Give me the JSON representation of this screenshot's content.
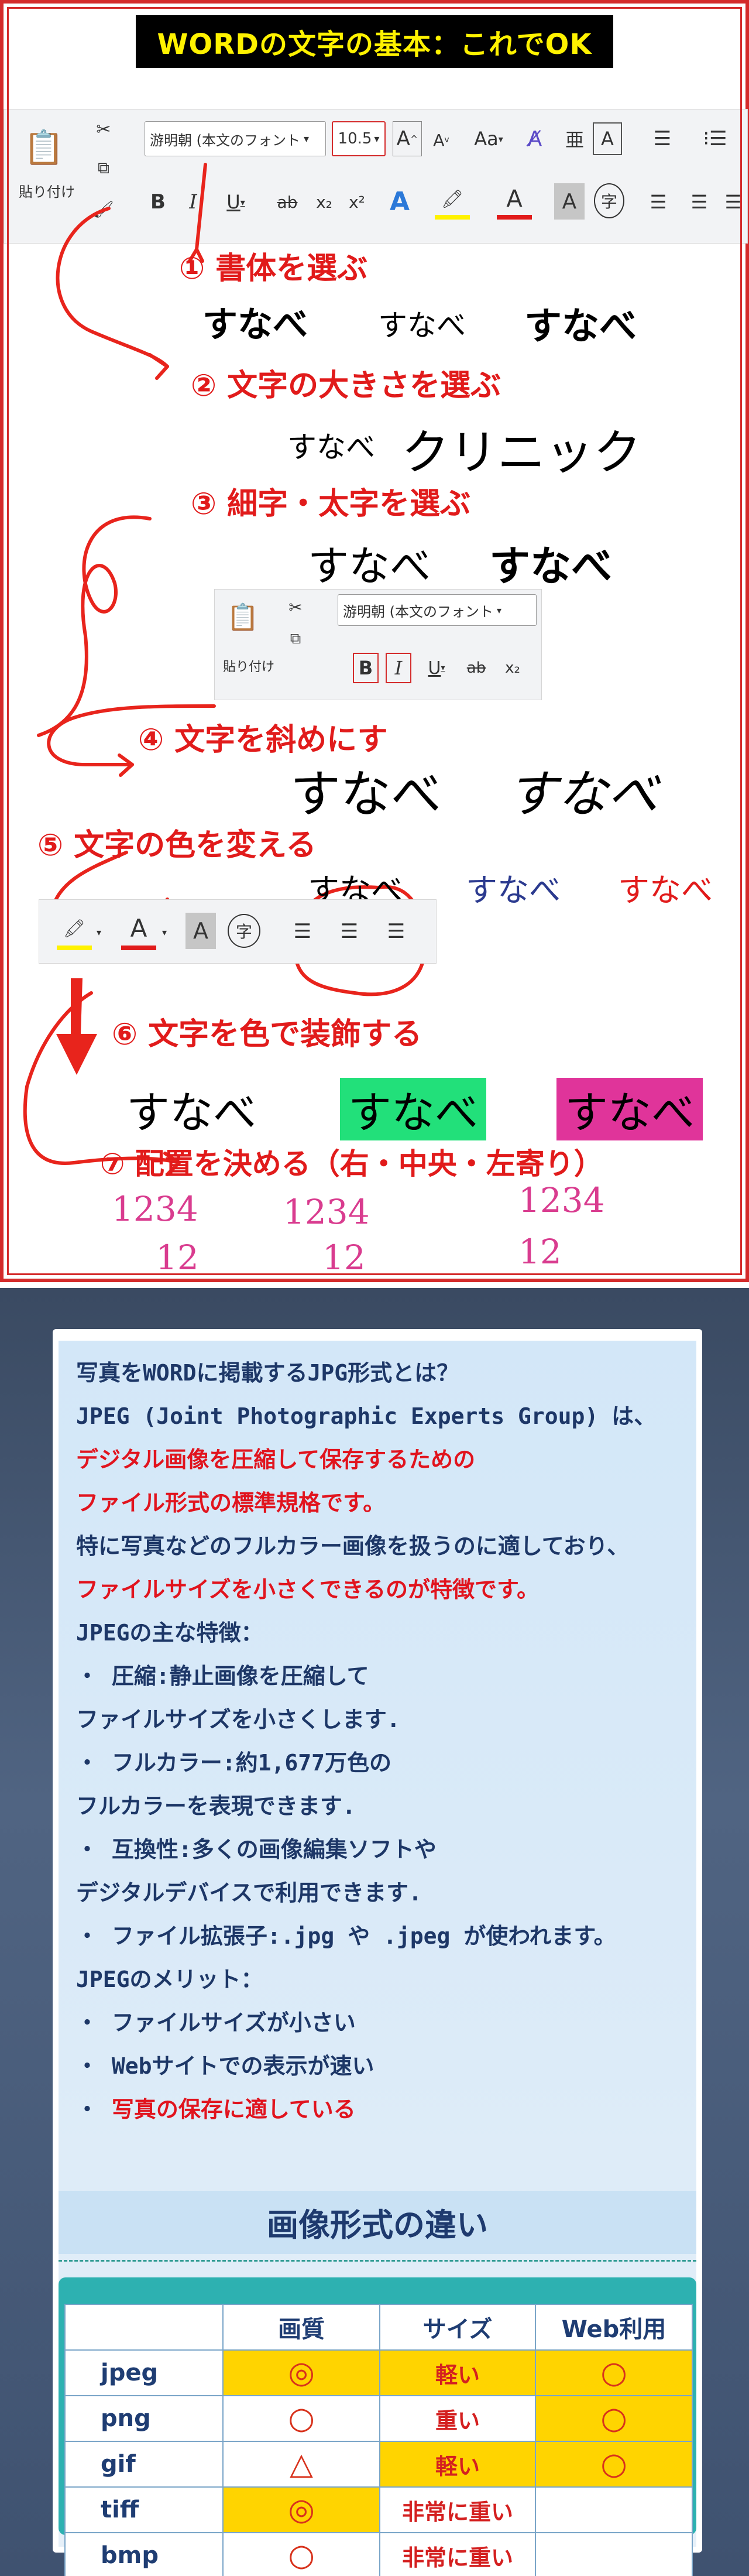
{
  "banner": "WORDの文字の基本：これでOK",
  "ribbon1": {
    "paste": "貼り付け",
    "font_name": "游明朝 (本文のフォント",
    "font_size": "10.5",
    "grow": "A",
    "shrink": "A",
    "case": "Aa",
    "bold": "B",
    "italic": "I",
    "underline": "U",
    "strike": "ab",
    "sub": "x₂",
    "sup": "x²",
    "effects": "A",
    "highlight": "🖍",
    "color": "A",
    "shade": "A",
    "enclose": "字",
    "ruby": "亜",
    "border": "A"
  },
  "ribbon2": {
    "paste": "貼り付け",
    "font_name": "游明朝 (本文のフォント",
    "bold": "B",
    "italic": "I",
    "underline": "U",
    "strike": "ab",
    "sub": "x₂"
  },
  "steps": [
    {
      "title": "① 書体を選ぶ"
    },
    {
      "title": "② 文字の大きさを選ぶ"
    },
    {
      "title": "③ 細字・太字を選ぶ"
    },
    {
      "title": "④ 文字を斜めにす"
    },
    {
      "title": "⑤ 文字の色を変える"
    },
    {
      "title": "⑥ 文字を色で装飾する"
    },
    {
      "title": "⑦ 配置を決める（右・中央・左寄り）"
    }
  ],
  "samples": {
    "font1": "すなべ",
    "font2": "すなべ",
    "font3": "すなべ",
    "size_a": "すなべ",
    "size_b": "クリニック",
    "weight_light": "すなべ",
    "weight_bold": "すなべ",
    "italic_a": "すなべ",
    "italic_b": "すなべ",
    "color_black": "すなべ",
    "color_blue": "すなべ",
    "color_red": "すなべ",
    "deco_plain": "すなべ",
    "deco_green": "すなべ",
    "deco_pink": "すなべ",
    "align_left_1": "1234",
    "align_left_2": "12",
    "align_center_1": "1234",
    "align_center_2": "12",
    "align_right_1": "1234",
    "align_right_2": "12"
  },
  "color_toolbar": {
    "highlight": "🖍",
    "color": "A",
    "shade": "A",
    "enclose": "字"
  },
  "colors": {
    "accent_red": "#e11b1b",
    "banner_text": "#fff200",
    "sample_blue": "#2b3a8f",
    "sample_red": "#e11b1b",
    "deco_green": "#22e07a",
    "deco_pink": "#e0349a",
    "align_pink": "#d93c8f"
  },
  "jpeg_text": [
    {
      "text": "写真をWORDに掲載するJPG形式とは？",
      "red": false
    },
    {
      "text": "JPEG (Joint Photographic Experts Group) は、",
      "red": false
    },
    {
      "text": "デジタル画像を圧縮して保存するための",
      "red": true
    },
    {
      "text": "ファイル形式の標準規格です。",
      "red": true
    },
    {
      "text": "特に写真などのフルカラー画像を扱うのに適しており、",
      "red": false
    },
    {
      "text": "ファイルサイズを小さくできるのが特徴です。",
      "red": true
    },
    {
      "text": "JPEGの主な特徴：",
      "red": false
    },
    {
      "text": "・ 圧縮:静止画像を圧縮して",
      "red": false
    },
    {
      "text": "ファイルサイズを小さくします.",
      "red": false
    },
    {
      "text": "・ フルカラー:約1,677万色の",
      "red": false
    },
    {
      "text": "フルカラーを表現できます.",
      "red": false
    },
    {
      "text": "・ 互換性:多くの画像編集ソフトや",
      "red": false
    },
    {
      "text": "デジタルデバイスで利用できます.",
      "red": false
    },
    {
      "text": "・ ファイル拡張子:.jpg や .jpeg が使われます。",
      "red": false
    },
    {
      "text": "JPEGのメリット：",
      "red": false
    },
    {
      "text": "・ ファイルサイズが小さい",
      "red": false
    },
    {
      "text": "・ Webサイトでの表示が速い",
      "red": false
    },
    {
      "text": "・ 写真の保存に適している",
      "red": "partial"
    }
  ],
  "table": {
    "title": "画像形式の違い",
    "headers": [
      "",
      "画質",
      "サイズ",
      "Web利用"
    ],
    "rows": [
      {
        "name": "jpeg",
        "quality": "◎",
        "size": "軽い",
        "web": "○"
      },
      {
        "name": "png",
        "quality": "○",
        "size": "重い",
        "web": "○"
      },
      {
        "name": "gif",
        "quality": "△",
        "size": "軽い",
        "web": "○"
      },
      {
        "name": "tiff",
        "quality": "◎",
        "size": "非常に重い",
        "web": ""
      },
      {
        "name": "bmp",
        "quality": "○",
        "size": "非常に重い",
        "web": ""
      }
    ]
  }
}
